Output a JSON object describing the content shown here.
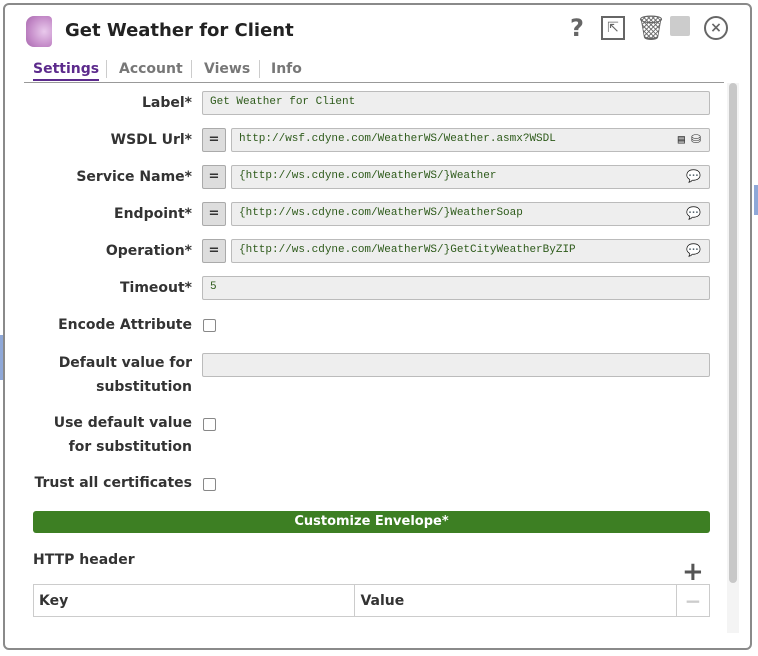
{
  "header": {
    "title": "Get Weather for Client",
    "icons": [
      "help-icon",
      "export-icon",
      "trash-icon",
      "save-icon",
      "close-icon"
    ]
  },
  "tabs": [
    "Settings",
    "Account",
    "Views",
    "Info"
  ],
  "fields": {
    "label": {
      "label": "Label*",
      "value": "Get Weather for Client"
    },
    "wsdl": {
      "label": "WSDL Url*",
      "value": "http://wsf.cdyne.com/WeatherWS/Weather.asmx?WSDL"
    },
    "service": {
      "label": "Service Name*",
      "value": "{http://ws.cdyne.com/WeatherWS/}Weather"
    },
    "endpoint": {
      "label": "Endpoint*",
      "value": "{http://ws.cdyne.com/WeatherWS/}WeatherSoap"
    },
    "operation": {
      "label": "Operation*",
      "value": "{http://ws.cdyne.com/WeatherWS/}GetCityWeatherByZIP"
    },
    "timeout": {
      "label": "Timeout*",
      "value": "5"
    },
    "encode": {
      "label": "Encode Attribute",
      "checked": false
    },
    "default_value": {
      "label1": "Default value for",
      "label2": "substitution",
      "value": ""
    },
    "use_default": {
      "label1": "Use default value",
      "label2": "for substitution",
      "checked": false
    },
    "trust": {
      "label": "Trust all certificates",
      "checked": false
    }
  },
  "eq_label": "=",
  "customize_button": "Customize Envelope*",
  "http_header": {
    "title": "HTTP header",
    "columns": [
      "Key",
      "Value"
    ]
  },
  "accent": "#5c2a8c",
  "button_color": "#3d7f23"
}
